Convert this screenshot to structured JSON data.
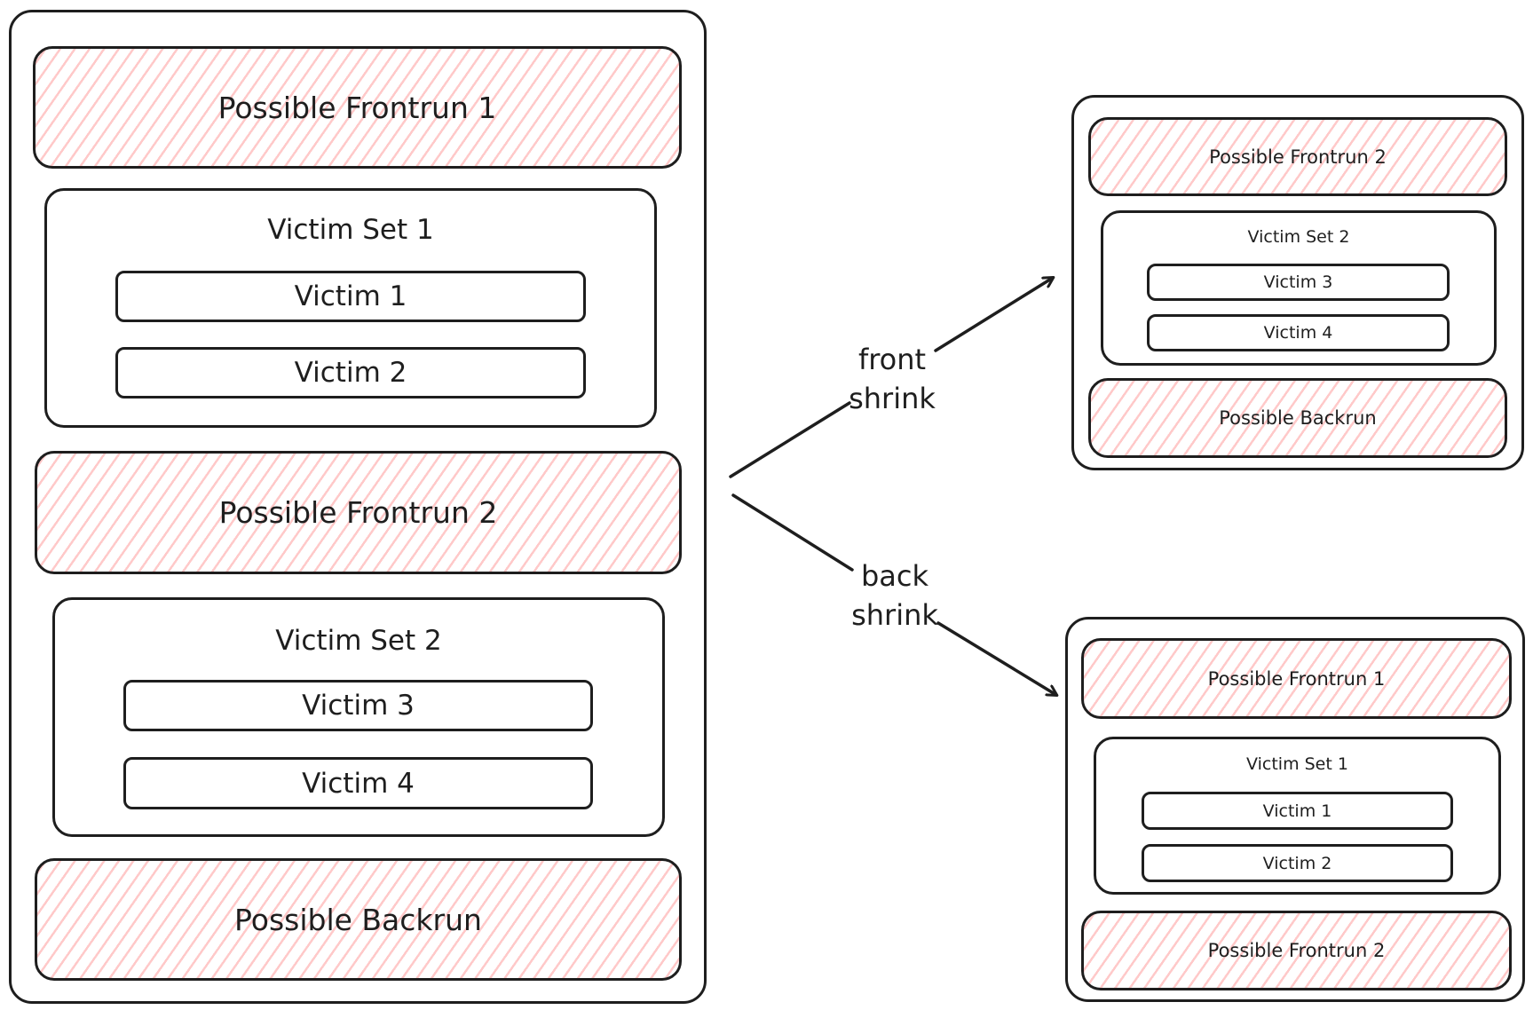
{
  "main": {
    "source": {
      "frontrun_1": "Possible Frontrun 1",
      "victim_set_1": {
        "title": "Victim Set 1",
        "victims": [
          "Victim 1",
          "Victim 2"
        ]
      },
      "frontrun_2": "Possible Frontrun 2",
      "victim_set_2": {
        "title": "Victim Set 2",
        "victims": [
          "Victim 3",
          "Victim 4"
        ]
      },
      "backrun": "Possible Backrun"
    },
    "front_shrink": {
      "label_line1": "front",
      "label_line2": "shrink",
      "result": {
        "frontrun": "Possible Frontrun 2",
        "victim_set": {
          "title": "Victim Set 2",
          "victims": [
            "Victim 3",
            "Victim 4"
          ]
        },
        "backrun": "Possible Backrun"
      }
    },
    "back_shrink": {
      "label_line1": "back",
      "label_line2": "shrink",
      "result": {
        "frontrun": "Possible Frontrun 1",
        "victim_set": {
          "title": "Victim Set 1",
          "victims": [
            "Victim 1",
            "Victim 2"
          ]
        },
        "backrun": "Possible Frontrun 2"
      }
    }
  },
  "colors": {
    "stroke": "#1e1e1e",
    "hatch": "#ffc9c9",
    "background": "#ffffff"
  }
}
